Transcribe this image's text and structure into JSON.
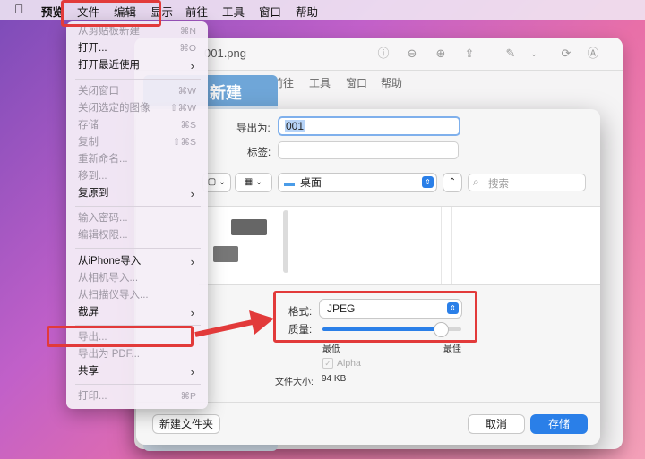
{
  "menubar": {
    "apple_icon": "apple-icon",
    "items": [
      "预览",
      "文件",
      "编辑",
      "显示",
      "前往",
      "工具",
      "窗口",
      "帮助"
    ]
  },
  "bg_window": {
    "title": "001.png",
    "menu_items": [
      "前往",
      "工具",
      "窗口",
      "帮助"
    ],
    "page_heading": "新建",
    "toolbar_icons": [
      "info-icon",
      "zoom-out-icon",
      "zoom-in-icon",
      "share-icon",
      "markup-icon",
      "chevron-down-icon",
      "rotate-icon",
      "annotate-icon"
    ]
  },
  "file_menu": {
    "groups": [
      [
        {
          "label": "从剪贴板新建",
          "shortcut": "⌘N",
          "enabled": false
        },
        {
          "label": "打开...",
          "shortcut": "⌘O",
          "enabled": true
        },
        {
          "label": "打开最近使用",
          "submenu": true,
          "enabled": true
        }
      ],
      [
        {
          "label": "关闭窗口",
          "shortcut": "⌘W",
          "enabled": false
        },
        {
          "label": "关闭选定的图像",
          "shortcut": "⇧⌘W",
          "enabled": false
        },
        {
          "label": "存储",
          "shortcut": "⌘S",
          "enabled": false
        },
        {
          "label": "复制",
          "shortcut": "⇧⌘S",
          "enabled": false
        },
        {
          "label": "重新命名...",
          "enabled": false
        },
        {
          "label": "移到...",
          "enabled": false
        },
        {
          "label": "复原到",
          "submenu": true,
          "enabled": true
        }
      ],
      [
        {
          "label": "输入密码...",
          "enabled": false
        },
        {
          "label": "编辑权限...",
          "enabled": false
        }
      ],
      [
        {
          "label": "从iPhone导入",
          "submenu": true,
          "enabled": true
        },
        {
          "label": "从相机导入...",
          "enabled": false
        },
        {
          "label": "从扫描仪导入...",
          "enabled": false
        },
        {
          "label": "截屏",
          "submenu": true,
          "enabled": true
        }
      ],
      [
        {
          "label": "导出...",
          "enabled": false
        },
        {
          "label": "导出为 PDF...",
          "enabled": false
        },
        {
          "label": "共享",
          "submenu": true,
          "enabled": true
        }
      ],
      [
        {
          "label": "打印...",
          "shortcut": "⌘P",
          "enabled": false
        }
      ]
    ]
  },
  "dialog": {
    "export_as_label": "导出为:",
    "export_as_value": "001",
    "tags_label": "标签:",
    "location": "桌面",
    "search_placeholder": "搜索",
    "format_label": "格式:",
    "format_value": "JPEG",
    "quality_label": "质量:",
    "quality_value": 0.85,
    "quality_min": "最低",
    "quality_max": "最佳",
    "alpha_label": "Alpha",
    "file_size_label": "文件大小:",
    "file_size_value": "94 KB",
    "new_folder_button": "新建文件夹",
    "cancel_button": "取消",
    "save_button": "存储"
  },
  "colors": {
    "annotation_red": "#e23a3a",
    "accent_blue": "#2a7fe8"
  }
}
